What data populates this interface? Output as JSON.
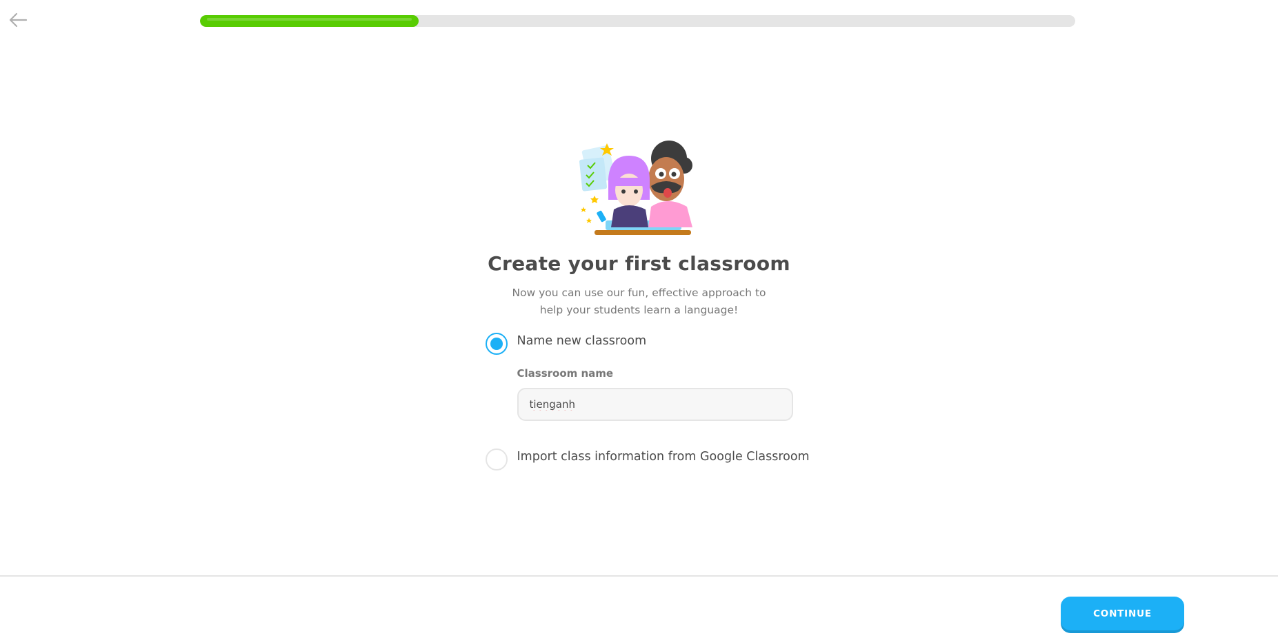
{
  "header": {
    "back_icon": "arrow-left-icon",
    "progress": {
      "value": 0.25
    }
  },
  "main": {
    "illustration": "teacher-and-student-illustration",
    "title": "Create your first classroom",
    "subtitle": "Now you can use our fun, effective approach to help your students learn a language!",
    "options": [
      {
        "label": "Name new classroom",
        "selected": true
      },
      {
        "label": "Import class information from Google Classroom",
        "selected": false
      }
    ],
    "classroom_field": {
      "label": "Classroom name",
      "value": "tienganh"
    }
  },
  "footer": {
    "continue_label": "CONTINUE"
  },
  "colors": {
    "progress": "#58cc02",
    "accent": "#1cb0f6",
    "text": "#4b4b4b"
  }
}
